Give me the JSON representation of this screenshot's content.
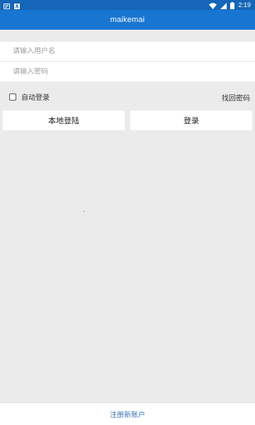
{
  "status_bar": {
    "time": "2:19",
    "left_icons": [
      "notification-icon",
      "a-app-icon"
    ],
    "right_icons": [
      "wifi-icon",
      "signal-icon",
      "battery-icon"
    ]
  },
  "app": {
    "title": "maikemai"
  },
  "form": {
    "username_placeholder": "请输入用户名",
    "password_placeholder": "请输入密码",
    "username_value": "",
    "password_value": ""
  },
  "options": {
    "auto_login_label": "自动登录",
    "auto_login_checked": false,
    "forgot_password_label": "找回密码"
  },
  "buttons": {
    "local_login_label": "本地登陆",
    "login_label": "登录"
  },
  "footer": {
    "register_label": "注册新账户"
  },
  "colors": {
    "status_bar": "#1565b8",
    "app_bar": "#1876d2",
    "background": "#ebebeb",
    "link": "#3d74b5"
  }
}
